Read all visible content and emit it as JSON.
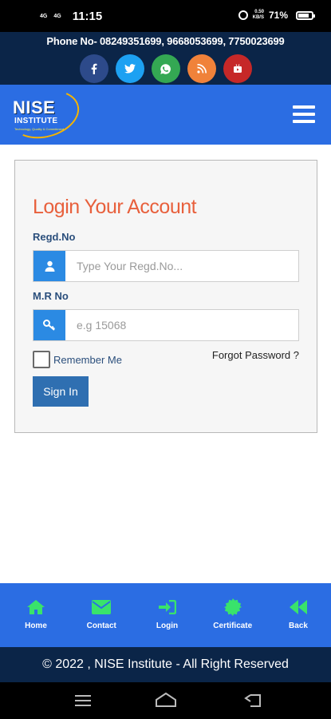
{
  "status_bar": {
    "network_top": "4G",
    "network_bottom": "4G",
    "time": "11:15",
    "speed_top": "0.50",
    "speed_bottom": "KB/S",
    "battery": "71%"
  },
  "topbar": {
    "phone": "Phone No- 08249351699, 9668053699, 7750023699",
    "socials": [
      {
        "name": "facebook",
        "glyph": "f",
        "color": "#2d4a8a"
      },
      {
        "name": "twitter",
        "glyph": "t",
        "color": "#1da1f2"
      },
      {
        "name": "whatsapp",
        "glyph": "w",
        "color": "#34a853"
      },
      {
        "name": "rss",
        "glyph": "r",
        "color": "#f0823a"
      },
      {
        "name": "youtube",
        "glyph": "▶",
        "color": "#c62828"
      }
    ]
  },
  "header": {
    "logo_main": "NISE",
    "logo_sub": "INSTITUTE",
    "logo_tag": "Technology, Quality & Commitment",
    "menu_icon": "hamburger-icon"
  },
  "login": {
    "title": "Login Your Account",
    "regd_label": "Regd.No",
    "regd_placeholder": "Type Your Regd.No...",
    "regd_value": "",
    "mr_label": "M.R No",
    "mr_placeholder": "e.g 15068",
    "mr_value": "",
    "remember_label": "Remember Me",
    "forgot_label": "Forgot Password ?",
    "signin_label": "Sign In"
  },
  "bottom_nav": {
    "items": [
      {
        "label": "Home",
        "icon": "home-icon"
      },
      {
        "label": "Contact",
        "icon": "envelope-icon"
      },
      {
        "label": "Login",
        "icon": "sign-in-icon"
      },
      {
        "label": "Certificate",
        "icon": "certificate-icon"
      },
      {
        "label": "Back",
        "icon": "backward-icon"
      }
    ]
  },
  "footer": {
    "text": "© 2022 , NISE Institute - All Right Reserved"
  },
  "colors": {
    "accent_green": "#39e36b",
    "header_blue": "#2b6de3",
    "navy": "#0b2548",
    "title_orange": "#e8603c"
  }
}
